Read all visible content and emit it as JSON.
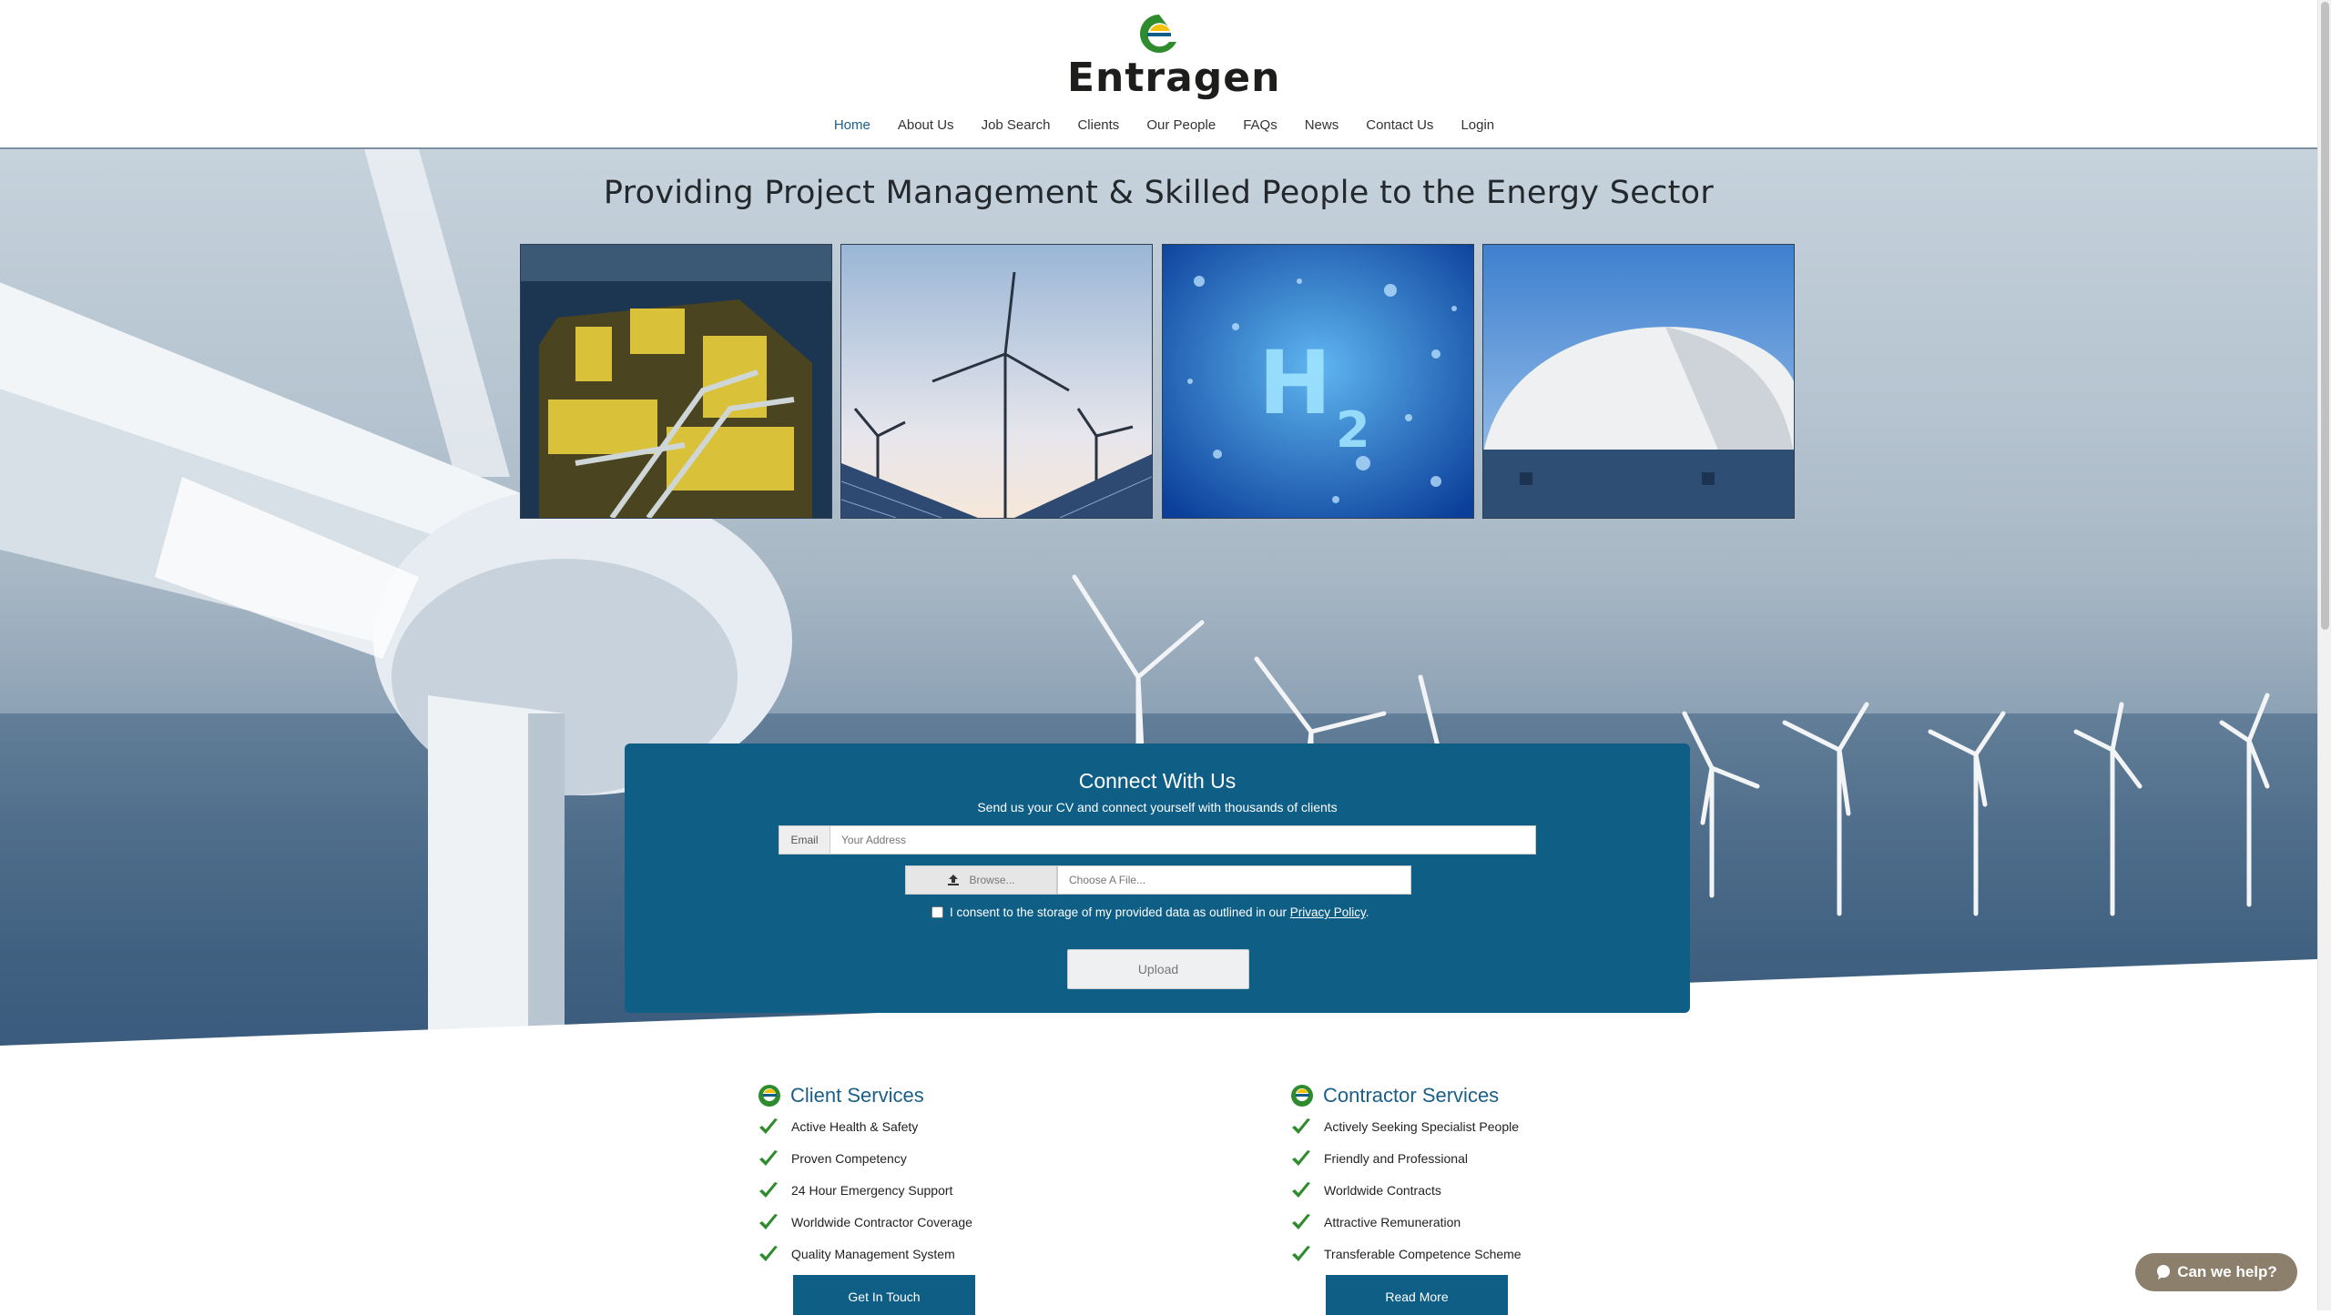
{
  "brand": {
    "name": "Entragen",
    "colors": {
      "primary": "#0e5e86",
      "accent_green": "#2e8b2e",
      "logo_yellow": "#f4c20d"
    }
  },
  "nav": {
    "items": [
      {
        "label": "Home",
        "active": true
      },
      {
        "label": "About Us"
      },
      {
        "label": "Job Search"
      },
      {
        "label": "Clients"
      },
      {
        "label": "Our People"
      },
      {
        "label": "FAQs"
      },
      {
        "label": "News"
      },
      {
        "label": "Contact Us"
      },
      {
        "label": "Login"
      }
    ]
  },
  "hero": {
    "title": "Providing Project Management & Skilled People to the Energy Sector",
    "tiles": [
      "offshore-platform-image",
      "wind-solar-image",
      "hydrogen-h2-image",
      "nuclear-dome-image"
    ]
  },
  "connect": {
    "title": "Connect With Us",
    "subtitle": "Send us your CV and connect yourself with thousands of clients",
    "email_label": "Email",
    "email_placeholder": "Your Address",
    "browse_label": "Browse...",
    "file_placeholder": "Choose A File...",
    "consent_text": "I consent to the storage of my provided data as outlined in our",
    "privacy_link": "Privacy Policy",
    "consent_end": ".",
    "upload_label": "Upload"
  },
  "services": {
    "client": {
      "title": "Client Services",
      "items": [
        "Active Health & Safety",
        "Proven Competency",
        "24 Hour Emergency Support",
        "Worldwide Contractor Coverage",
        "Quality Management System"
      ],
      "button": "Get In Touch"
    },
    "contractor": {
      "title": "Contractor Services",
      "items": [
        "Actively Seeking Specialist People",
        "Friendly and Professional",
        "Worldwide Contracts",
        "Attractive Remuneration",
        "Transferable Competence Scheme"
      ],
      "button": "Read More"
    }
  },
  "chat": {
    "label": "Can we help?"
  }
}
